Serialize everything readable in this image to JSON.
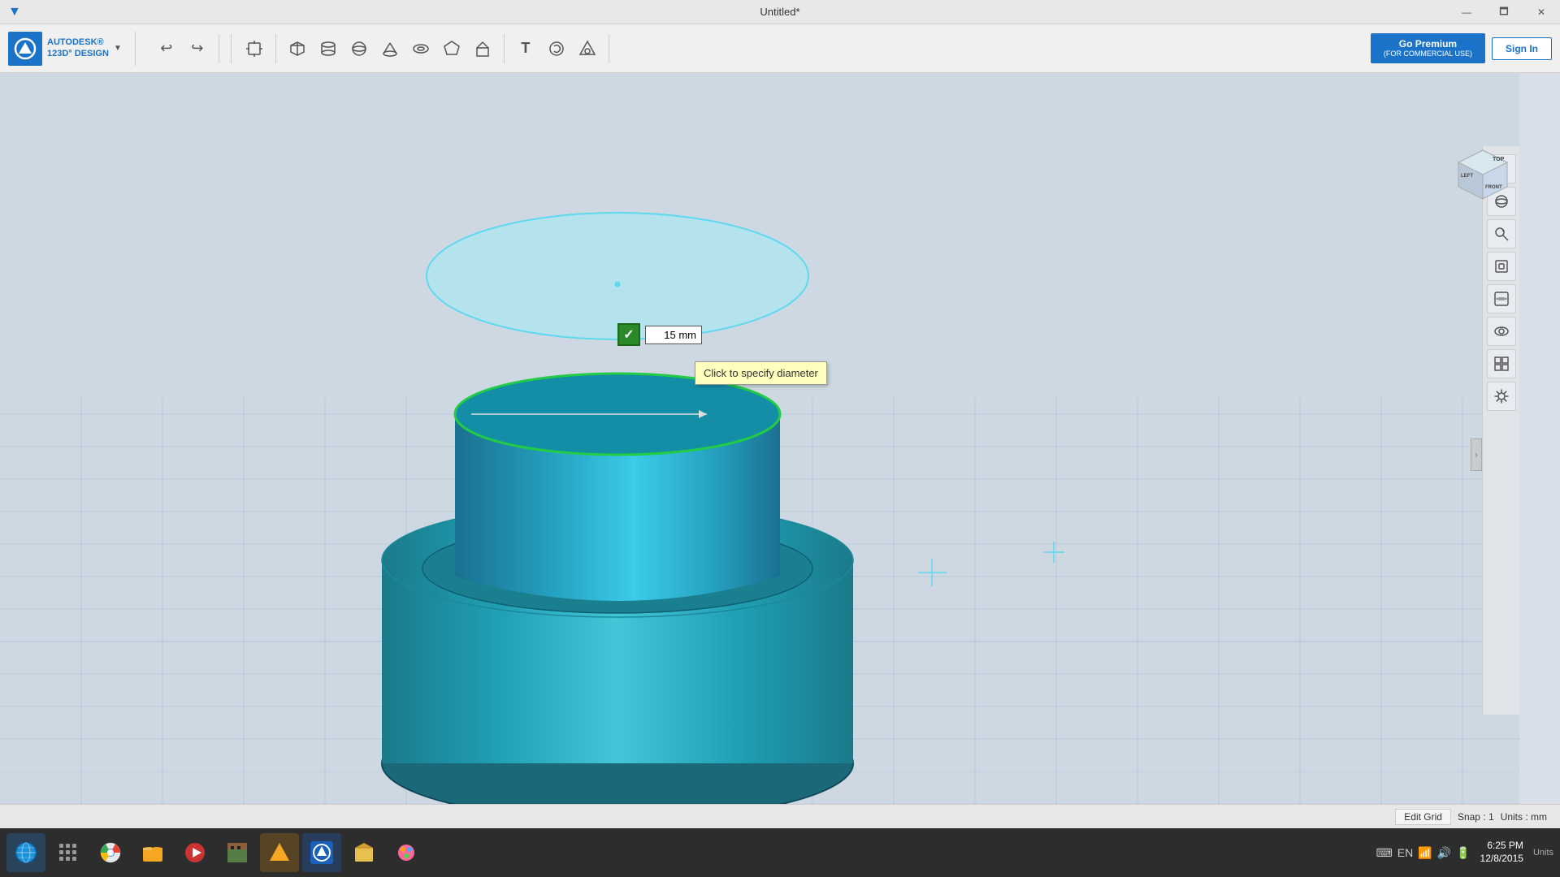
{
  "window": {
    "title": "Untitled*",
    "controls": {
      "restore": "🗖",
      "minimize": "—",
      "close": "✕"
    }
  },
  "logo": {
    "brand": "AUTODESK®",
    "product": "123D° DESIGN",
    "dropdown": "▼"
  },
  "toolbar": {
    "undo": "↩",
    "redo": "↪",
    "new_box": "⬛",
    "primitive1": "⬡",
    "primitive2": "⬟",
    "primitive3": "◈",
    "primitive4": "⬠",
    "primitive5": "⬣",
    "primitive6": "⬢",
    "primitive7": "⬤",
    "text_tool": "T",
    "script": "🔧",
    "material": "◉",
    "premium_label": "Go Premium",
    "premium_sub": "(FOR COMMERCIAL USE)",
    "signin": "Sign In"
  },
  "dimension": {
    "value": "15 mm",
    "check": "✓"
  },
  "tooltip": {
    "text": "Click to specify diameter"
  },
  "rightpanel": {
    "buttons": [
      "➕",
      "🌐",
      "🔍",
      "⬜",
      "⬛",
      "👁",
      "🗃",
      "⚙"
    ]
  },
  "viewcube": {
    "top": "TOP",
    "left": "LEFT",
    "front": "FRONT"
  },
  "bottombar": {
    "edit_grid": "Edit Grid",
    "snap_label": "Snap : 1",
    "units_label": "Units : mm"
  },
  "taskbar": {
    "icons": [
      "🌐",
      "🔵",
      "📁",
      "▶",
      "⛏",
      "🦅",
      "🔷",
      "📦",
      "🎨"
    ],
    "clock_time": "6:25 PM",
    "clock_date": "12/8/2015",
    "units_label": "Units"
  }
}
